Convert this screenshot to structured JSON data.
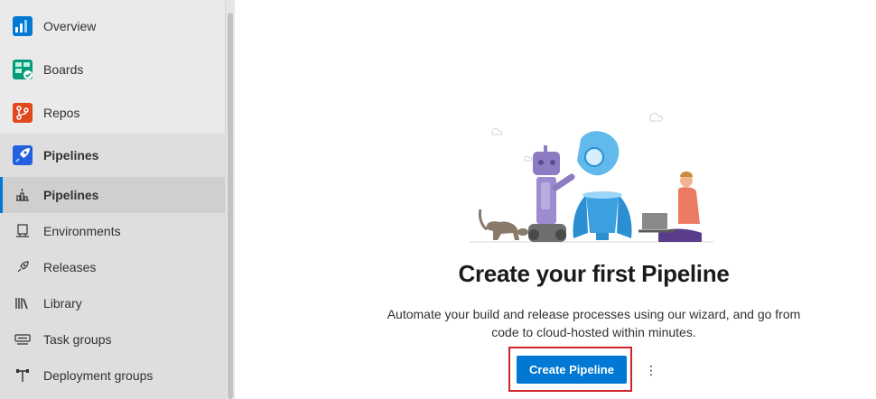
{
  "sidebar": {
    "items": [
      {
        "label": "Overview",
        "icon": "overview-icon"
      },
      {
        "label": "Boards",
        "icon": "boards-icon"
      },
      {
        "label": "Repos",
        "icon": "repos-icon"
      },
      {
        "label": "Pipelines",
        "icon": "pipelines-icon"
      }
    ],
    "sub_items": [
      {
        "label": "Pipelines",
        "icon": "pipelines-rocket-icon"
      },
      {
        "label": "Environments",
        "icon": "environments-icon"
      },
      {
        "label": "Releases",
        "icon": "releases-icon"
      },
      {
        "label": "Library",
        "icon": "library-icon"
      },
      {
        "label": "Task groups",
        "icon": "task-groups-icon"
      },
      {
        "label": "Deployment groups",
        "icon": "deployment-groups-icon"
      }
    ],
    "selected_sub_item": "Pipelines"
  },
  "main": {
    "title": "Create your first Pipeline",
    "description": "Automate your build and release processes using our wizard, and go from code to cloud-hosted within minutes.",
    "create_button_label": "Create Pipeline",
    "more_button_label": "⋮"
  },
  "colors": {
    "accent": "#0078d4",
    "highlight_border": "#d0232b",
    "sidebar_bg": "#eaeaea"
  }
}
